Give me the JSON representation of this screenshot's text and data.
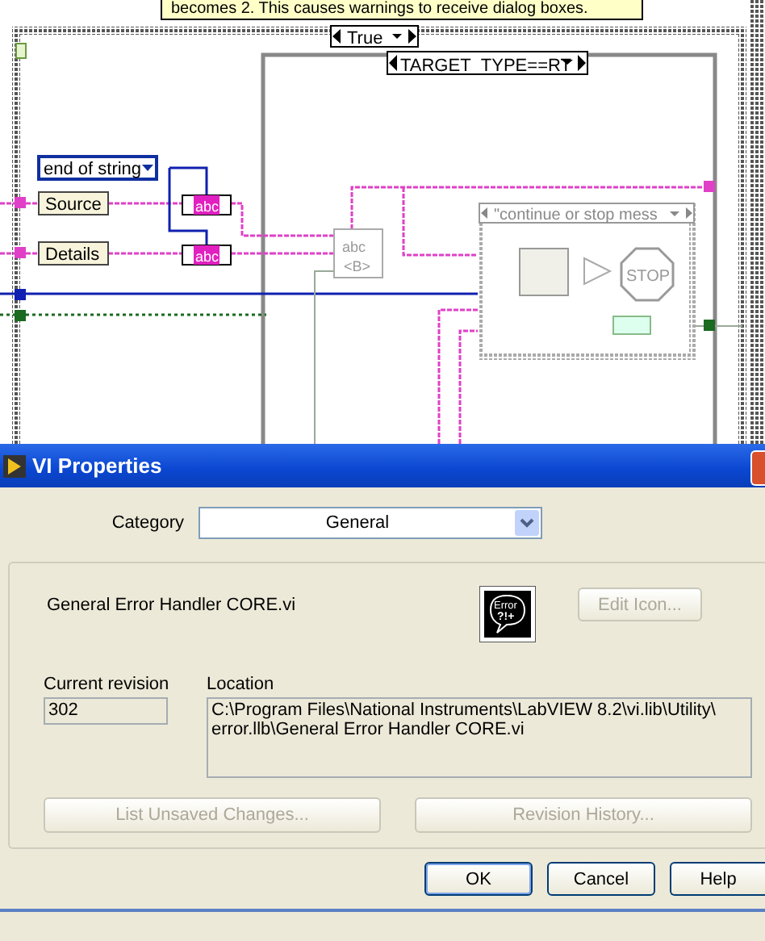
{
  "diagram": {
    "comment": "becomes 2. This causes warnings to receive dialog boxes.",
    "case_selector": "True",
    "inner_selector": "TARGET_TYPE==RT",
    "enum_value": "end of string",
    "labels": [
      "Source",
      "Details"
    ],
    "concat_nodes": [
      "abc",
      "abc"
    ],
    "format_node": [
      "abc",
      "<B>"
    ],
    "nested_selector": "\"continue or stop mess",
    "stop_text": "STOP"
  },
  "dialog": {
    "title": "VI Properties",
    "category_label": "Category",
    "category_value": "General",
    "vi_name": "General Error Handler CORE.vi",
    "icon_text": [
      "Error",
      "?!+"
    ],
    "edit_icon_button": {
      "label": "Edit Icon...",
      "disabled": true
    },
    "revision_label": "Current revision",
    "revision_value": "302",
    "location_label": "Location",
    "location_lines": [
      "C:\\Program Files\\National Instruments\\LabVIEW 8.2\\vi.lib\\Utility\\",
      "error.llb\\General Error Handler CORE.vi"
    ],
    "action_buttons": [
      {
        "label": "List Unsaved Changes...",
        "disabled": true
      },
      {
        "label": "Revision History...",
        "disabled": true
      }
    ],
    "footer_buttons": [
      {
        "label": "OK",
        "default": true
      },
      {
        "label": "Cancel",
        "default": false
      },
      {
        "label": "Help",
        "default": false
      }
    ]
  }
}
